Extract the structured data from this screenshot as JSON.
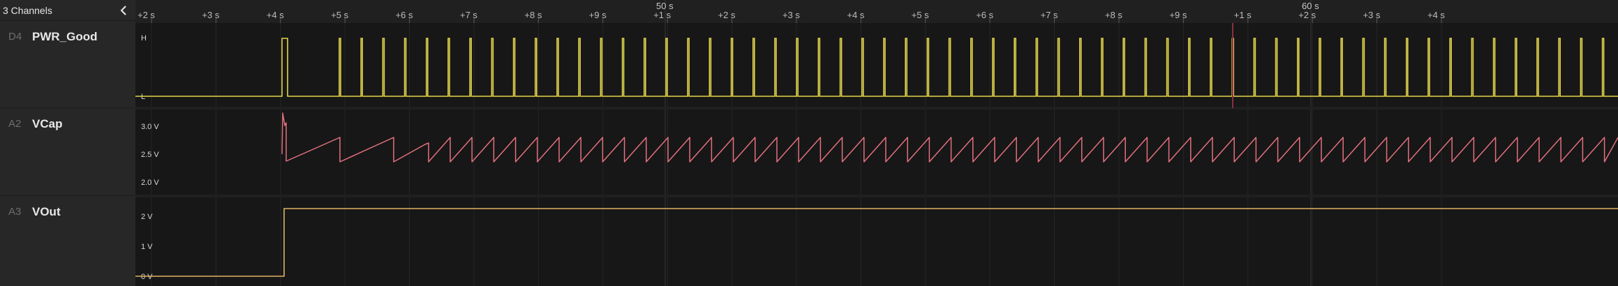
{
  "sidebar": {
    "title": "3 Channels",
    "collapse_icon": "chevron-left-icon",
    "channels": [
      {
        "id": "D4",
        "name": "PWR_Good"
      },
      {
        "id": "A2",
        "name": "VCap"
      },
      {
        "id": "A3",
        "name": "VOut"
      }
    ]
  },
  "timeline": {
    "major_labels": [
      "50 s",
      "60 s"
    ],
    "tick_labels": [
      "+2 s",
      "+3 s",
      "+4 s",
      "+5 s",
      "+6 s",
      "+7 s",
      "+8 s",
      "+9 s",
      "+1 s",
      "+2 s",
      "+3 s",
      "+4 s",
      "+5 s",
      "+6 s",
      "+7 s",
      "+8 s",
      "+9 s",
      "+1 s",
      "+2 s",
      "+3 s",
      "+4 s"
    ]
  },
  "tracks": {
    "pwr_good": {
      "axis_labels": [
        "H",
        "L"
      ],
      "color": "#e2d54b"
    },
    "vcap": {
      "axis_labels": [
        "3.0 V",
        "2.5 V",
        "2.0 V"
      ],
      "color": "#e3707e",
      "cursor_color": "#8c2f44"
    },
    "vout": {
      "axis_labels": [
        "2 V",
        "1 V",
        "0 V"
      ],
      "color": "#e0b263"
    }
  },
  "colors": {
    "background": "#171717",
    "sidebar": "#272727",
    "grid": "#262626",
    "major_grid": "#343434"
  }
}
